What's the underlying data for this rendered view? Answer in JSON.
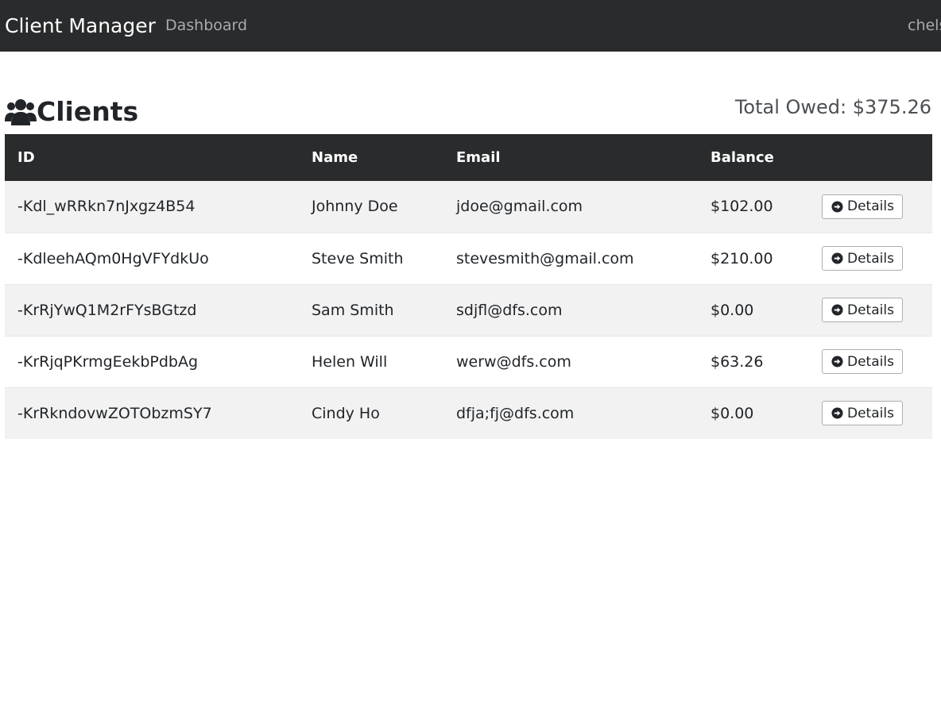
{
  "navbar": {
    "brand": "Client Manager",
    "links": [
      "Dashboard"
    ],
    "user": "chels"
  },
  "page": {
    "title": "Clients",
    "title_icon": "users-icon",
    "total_owed_label": "Total Owed: $375.26"
  },
  "table": {
    "headers": [
      "ID",
      "Name",
      "Email",
      "Balance",
      ""
    ],
    "rows": [
      {
        "id": "-Kdl_wRRkn7nJxgz4B54",
        "name": "Johnny Doe",
        "email": "jdoe@gmail.com",
        "balance": "$102.00",
        "owed": true,
        "action": "Details"
      },
      {
        "id": "-KdleehAQm0HgVFYdkUo",
        "name": "Steve Smith",
        "email": "stevesmith@gmail.com",
        "balance": "$210.00",
        "owed": true,
        "action": "Details"
      },
      {
        "id": "-KrRjYwQ1M2rFYsBGtzd",
        "name": "Sam Smith",
        "email": "sdjfl@dfs.com",
        "balance": "$0.00",
        "owed": false,
        "action": "Details"
      },
      {
        "id": "-KrRjqPKrmgEekbPdbAg",
        "name": "Helen Will",
        "email": "werw@dfs.com",
        "balance": "$63.26",
        "owed": true,
        "action": "Details"
      },
      {
        "id": "-KrRkndovwZOTObzmSY7",
        "name": "Cindy Ho",
        "email": "dfja;fj@dfs.com",
        "balance": "$0.00",
        "owed": false,
        "action": "Details"
      }
    ]
  },
  "colors": {
    "navbar_bg": "#292b2c",
    "owed_text": "#c9302c",
    "striped_row": "#f2f2f2"
  }
}
